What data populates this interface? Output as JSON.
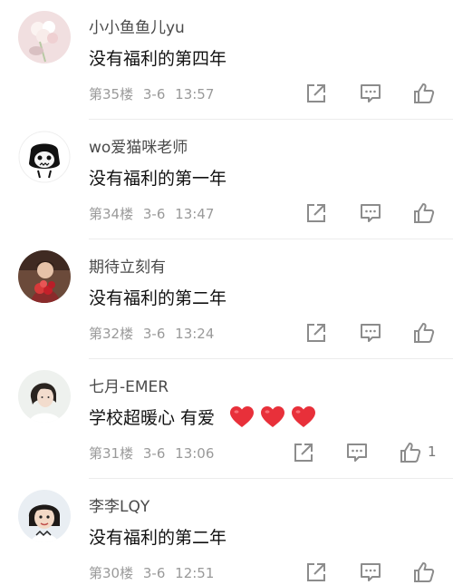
{
  "comments": [
    {
      "username": "小小鱼鱼儿yu",
      "text": "没有福利的第四年",
      "floor": "第35楼",
      "date": "3-6",
      "time": "13:57",
      "avatar_icon": "flower-avatar-icon"
    },
    {
      "username": "wo爱猫咪老师",
      "text": "没有福利的第一年",
      "floor": "第34楼",
      "date": "3-6",
      "time": "13:47",
      "avatar_icon": "cat-mask-avatar-icon"
    },
    {
      "username": "期待立刻有",
      "text": "没有福利的第二年",
      "floor": "第32楼",
      "date": "3-6",
      "time": "13:24",
      "avatar_icon": "person-flowers-avatar-icon"
    },
    {
      "username": "七月-EMER",
      "text": "学校超暖心 有爱",
      "floor": "第31楼",
      "date": "3-6",
      "time": "13:06",
      "like_count": "1",
      "avatar_icon": "girl-avatar-icon"
    },
    {
      "username": "李李LQY",
      "text": "没有福利的第二年",
      "floor": "第30楼",
      "date": "3-6",
      "time": "12:51",
      "avatar_icon": "child-avatar-icon"
    }
  ],
  "icons": {
    "share": "share-icon",
    "reply": "comment-icon",
    "like": "thumbs-up-icon",
    "heart": "red-heart-icon"
  },
  "colors": {
    "heart": "#e8303a",
    "icon_gray": "#8c8c8c",
    "meta_gray": "#9a9a9a"
  }
}
